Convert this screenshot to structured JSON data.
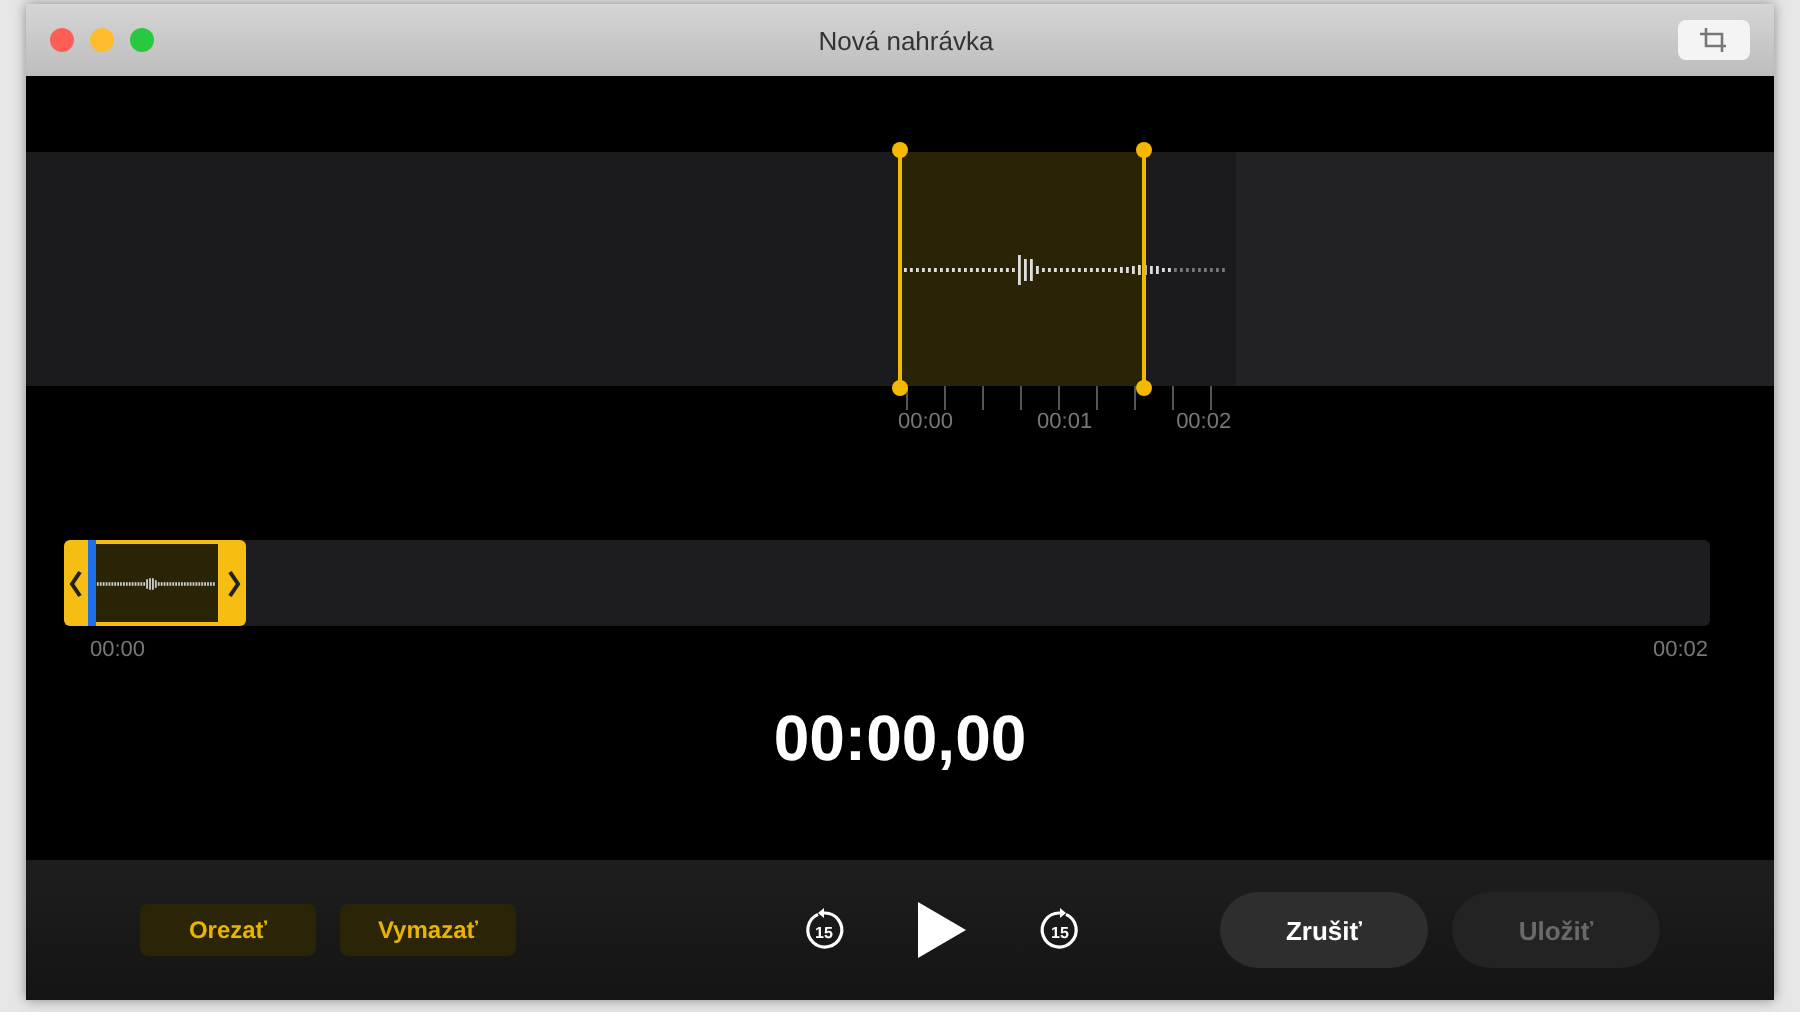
{
  "window": {
    "title": "Nová nahrávka"
  },
  "detail": {
    "ticks": [
      "00:00",
      "00:01",
      "00:02"
    ]
  },
  "overview": {
    "start": "00:00",
    "end": "00:02"
  },
  "time": "00:00,00",
  "edit_buttons": [
    {
      "label": "Orezať"
    },
    {
      "label": "Vymazať"
    }
  ],
  "transport": {
    "skip_back": "15",
    "skip_forward": "15"
  },
  "actions": [
    {
      "label": "Zrušiť",
      "disabled": false
    },
    {
      "label": "Uložiť",
      "disabled": true
    }
  ]
}
